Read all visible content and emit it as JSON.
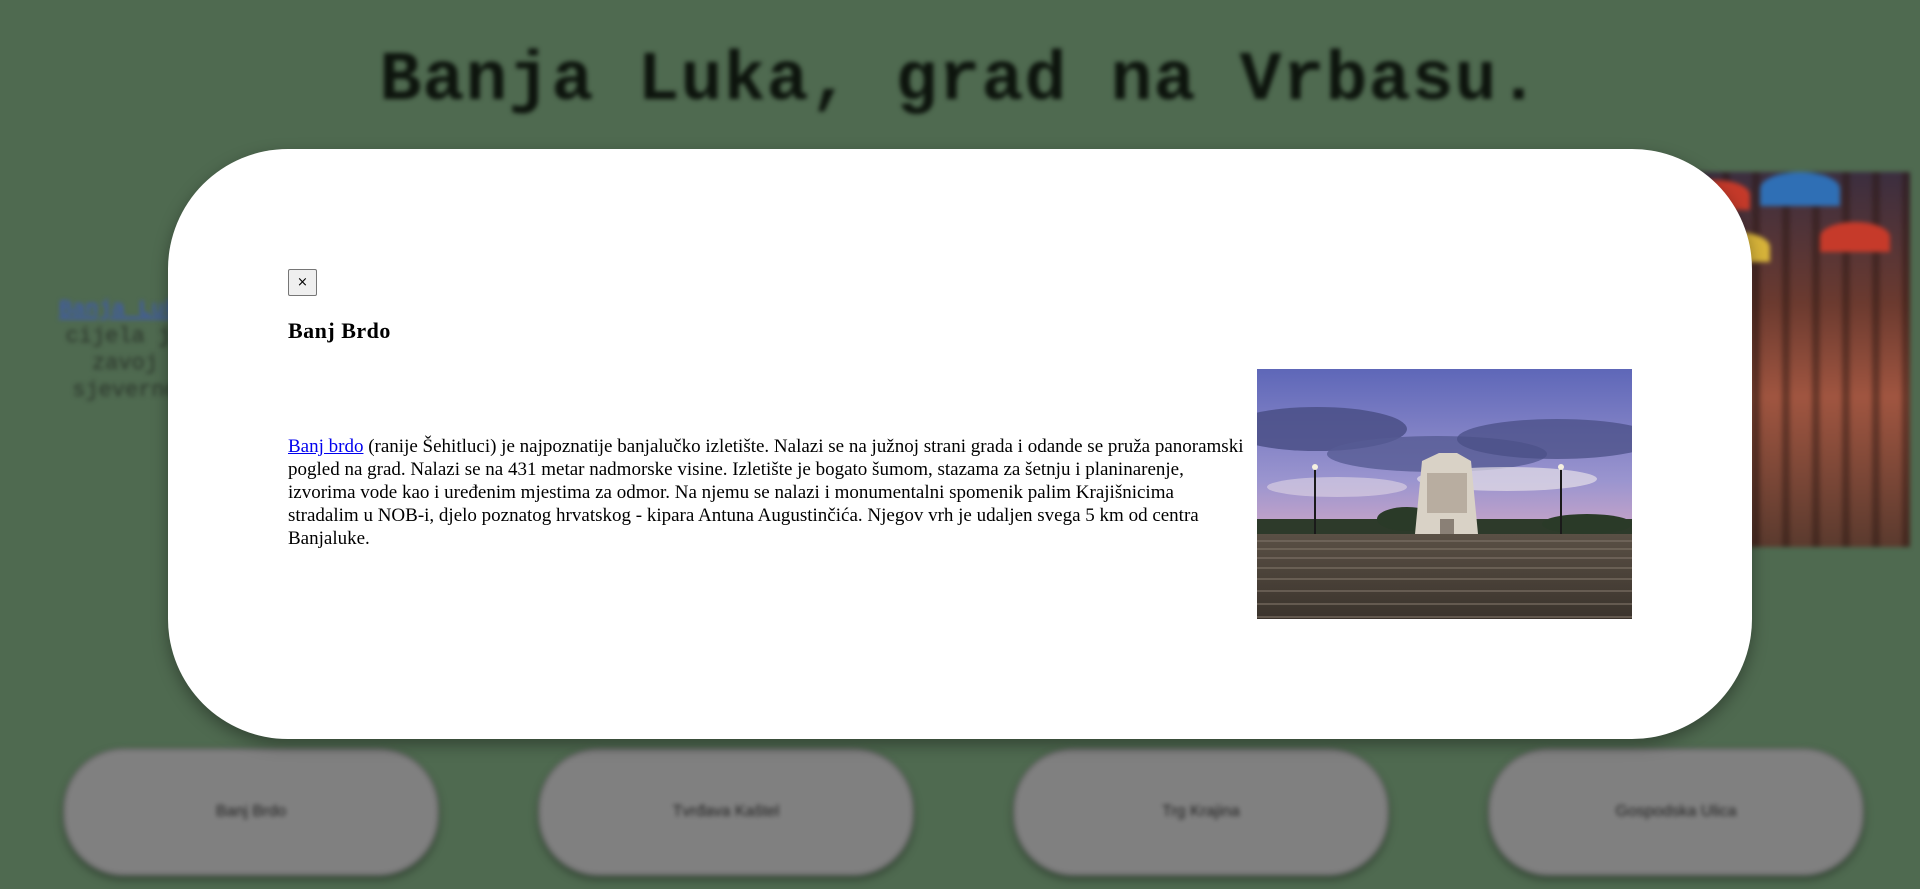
{
  "background": {
    "page_title": "Banja Luka, grad na Vrbasu.",
    "side_link": "Banja Luka",
    "side_text_lines": [
      "cijela je",
      "zavoj",
      "sjeverno"
    ],
    "buttons": [
      "Banj Brdo",
      "Tvrđava Kaštel",
      "Trg Krajina",
      "Gospodska Ulica"
    ]
  },
  "modal": {
    "close_label": "×",
    "title": "Banj Brdo",
    "link_text": "Banj brdo",
    "description": " (ranije Šehitluci) je najpoznatije banjalučko izletište. Nalazi se na južnoj strani grada i odande se pruža panoramski pogled na grad. Nalazi se na 431 metar nadmorske visine. Izletište je bogato šumom, stazama za šetnju i planinarenje, izvorima vode kao i uređenim mjestima za odmor. Na njemu se nalazi i monumentalni spomenik palim Krajišnicima stradalim u NOB-i, djelo poznatog hrvatskog - kipara Antuna Augustinčića. Njegov vrh je udaljen svega 5 km od centra Banjaluke."
  },
  "colors": {
    "overlay_bg": "#4f6a50",
    "link": "#0000ee",
    "button_bg": "#808080"
  },
  "icons": {
    "close": "close-icon"
  }
}
